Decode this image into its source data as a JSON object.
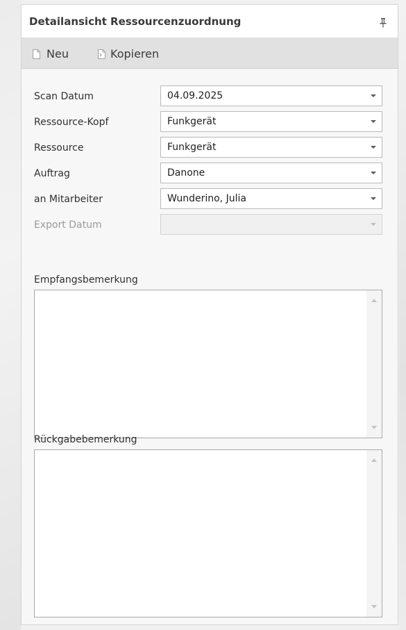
{
  "panel": {
    "title": "Detailansicht Ressourcenzuordnung",
    "pin_icon": "pin-icon"
  },
  "toolbar": {
    "new_label": "Neu",
    "new_icon": "new-document-icon",
    "copy_label": "Kopieren",
    "copy_icon": "copy-document-icon"
  },
  "form": {
    "scan_datum": {
      "label": "Scan Datum",
      "value": "04.09.2025"
    },
    "ressource_kopf": {
      "label": "Ressource-Kopf",
      "value": "Funkgerät"
    },
    "ressource": {
      "label": "Ressource",
      "value": "Funkgerät"
    },
    "auftrag": {
      "label": "Auftrag",
      "value": "Danone"
    },
    "an_mitarbeiter": {
      "label": "an Mitarbeiter",
      "value": "Wunderino, Julia"
    },
    "export_datum": {
      "label": "Export Datum",
      "value": ""
    }
  },
  "memos": {
    "empfangsbemerkung": {
      "label": "Empfangsbemerkung",
      "value": ""
    },
    "rueckgabebemerkung": {
      "label": "Rückgabebemerkung",
      "value": ""
    }
  },
  "colors": {
    "toolbar_bg": "#e1e1e1",
    "panel_bg": "#f7f7f7",
    "disabled_text": "#9a9a9a"
  }
}
